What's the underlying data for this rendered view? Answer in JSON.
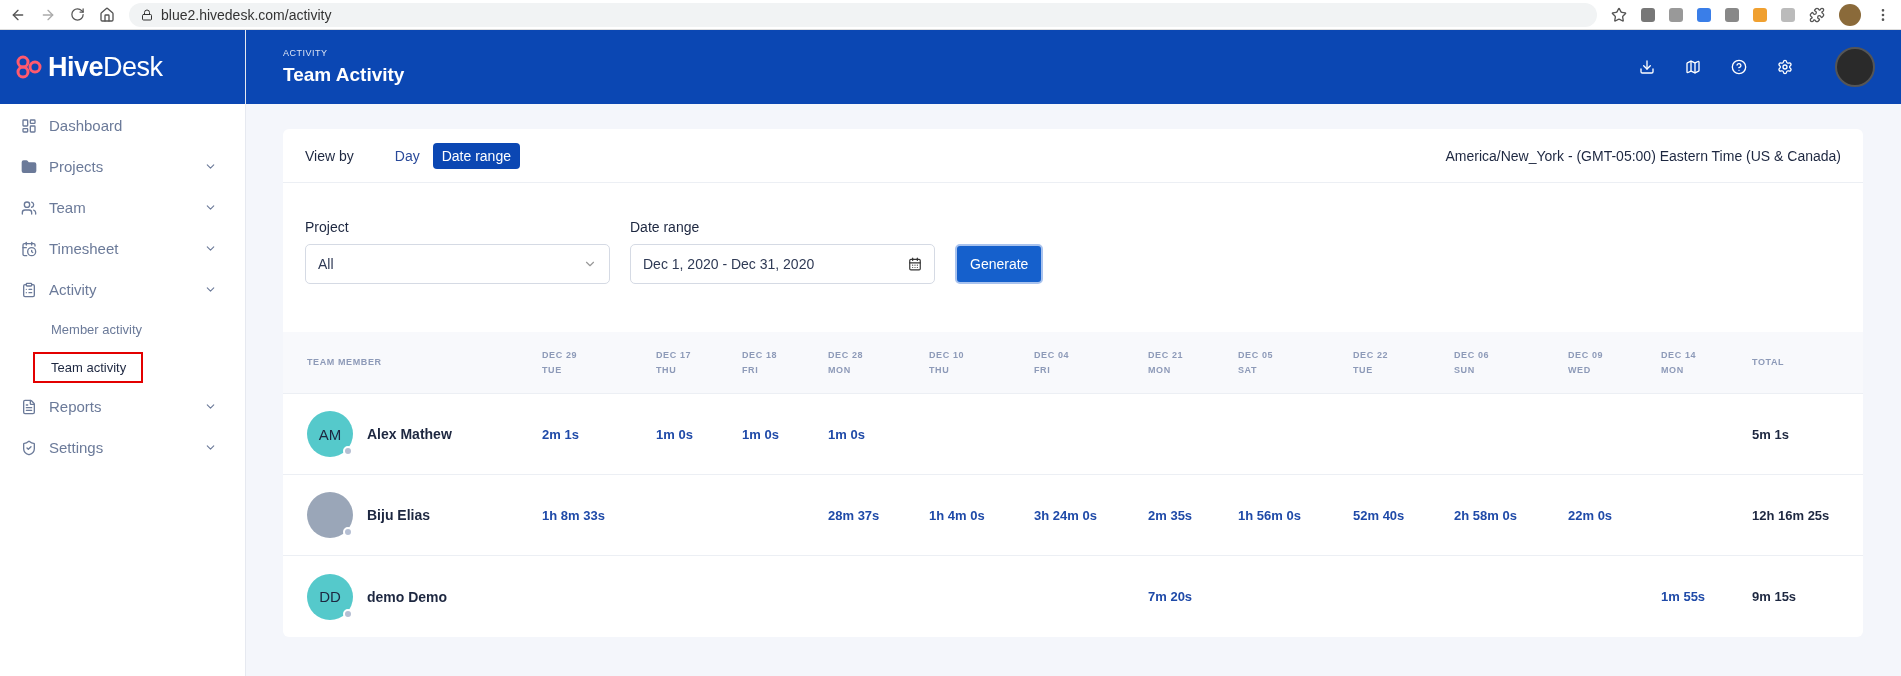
{
  "browser": {
    "url": "blue2.hivedesk.com/activity"
  },
  "logo": {
    "text": "**Hive**Desk"
  },
  "header": {
    "section": "ACTIVITY",
    "title": "Team Activity"
  },
  "sidebar": {
    "items": [
      {
        "label": "Dashboard",
        "has_menu": false
      },
      {
        "label": "Projects",
        "has_menu": true
      },
      {
        "label": "Team",
        "has_menu": true
      },
      {
        "label": "Timesheet",
        "has_menu": true
      },
      {
        "label": "Activity",
        "has_menu": true,
        "children": [
          {
            "label": "Member activity",
            "selected": false,
            "annotated": false
          },
          {
            "label": "Team activity",
            "selected": true,
            "annotated": true
          }
        ]
      },
      {
        "label": "Reports",
        "has_menu": true
      },
      {
        "label": "Settings",
        "has_menu": true
      }
    ]
  },
  "view_by": {
    "label": "View by",
    "options": [
      {
        "label": "Day",
        "selected": false
      },
      {
        "label": "Date range",
        "selected": true
      }
    ]
  },
  "timezone": "America/New_York - (GMT-05:00) Eastern Time (US & Canada)",
  "filters": {
    "project": {
      "label": "Project",
      "value": "All"
    },
    "date_range": {
      "label": "Date range",
      "value": "Dec 1, 2020 - Dec 31, 2020"
    },
    "button": "Generate"
  },
  "table": {
    "member_column": "TEAM MEMBER",
    "total_column": "TOTAL",
    "columns": [
      {
        "date": "DEC 29",
        "day": "TUE"
      },
      {
        "date": "DEC 17",
        "day": "THU"
      },
      {
        "date": "DEC 18",
        "day": "FRI"
      },
      {
        "date": "DEC 28",
        "day": "MON"
      },
      {
        "date": "DEC 10",
        "day": "THU"
      },
      {
        "date": "DEC 04",
        "day": "FRI"
      },
      {
        "date": "DEC 21",
        "day": "MON"
      },
      {
        "date": "DEC 05",
        "day": "SAT"
      },
      {
        "date": "DEC 22",
        "day": "TUE"
      },
      {
        "date": "DEC 06",
        "day": "SUN"
      },
      {
        "date": "DEC 09",
        "day": "WED"
      },
      {
        "date": "DEC 14",
        "day": "MON"
      }
    ],
    "rows": [
      {
        "name": "Alex Mathew",
        "avatar": {
          "kind": "initials",
          "initials": "AM"
        },
        "cells": [
          {
            "value": "2m 1s"
          },
          {
            "value": "1m 0s"
          },
          {
            "value": "1m 0s"
          },
          {
            "value": "1m 0s"
          },
          {},
          {},
          {},
          {},
          {},
          {},
          {},
          {}
        ],
        "total": "5m 1s"
      },
      {
        "name": "Biju Elias",
        "avatar": {
          "kind": "photo"
        },
        "cells": [
          {
            "value": "1h 8m 33s"
          },
          {},
          {},
          {
            "value": "28m 37s"
          },
          {
            "value": "1h 4m 0s"
          },
          {
            "value": "3h 24m 0s"
          },
          {
            "value": "2m 35s"
          },
          {
            "value": "1h 56m 0s"
          },
          {
            "value": "52m 40s"
          },
          {
            "value": "2h 58m 0s"
          },
          {
            "value": "22m 0s"
          },
          {}
        ],
        "total": "12h 16m 25s"
      },
      {
        "name": "demo Demo",
        "avatar": {
          "kind": "initials",
          "initials": "DD"
        },
        "cells": [
          {},
          {},
          {},
          {},
          {},
          {},
          {
            "value": "7m 20s"
          },
          {},
          {},
          {},
          {},
          {
            "value": "1m 55s"
          }
        ],
        "total": "9m 15s"
      }
    ]
  }
}
